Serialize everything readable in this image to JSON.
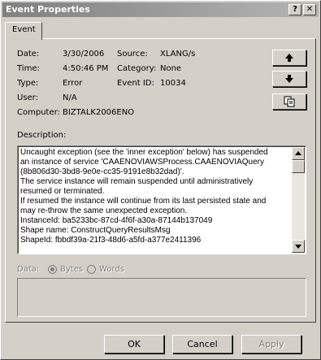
{
  "window": {
    "title": "Event Properties",
    "help_glyph": "?",
    "close_glyph": "✕"
  },
  "tabs": [
    {
      "label": "Event"
    }
  ],
  "fields": {
    "date": {
      "label": "Date:",
      "value": "3/30/2006"
    },
    "time": {
      "label": "Time:",
      "value": "4:50:46 PM"
    },
    "type": {
      "label": "Type:",
      "value": "Error"
    },
    "user": {
      "label": "User:",
      "value": "N/A"
    },
    "computer": {
      "label": "Computer:",
      "value": "BIZTALK2006ENO"
    },
    "source": {
      "label": "Source:",
      "value": "XLANG/s"
    },
    "category": {
      "label": "Category:",
      "value": "None"
    },
    "event_id": {
      "label": "Event ID:",
      "value": "10034"
    }
  },
  "side_buttons": {
    "up": "up-arrow-icon",
    "down": "down-arrow-icon",
    "copy": "copy-icon"
  },
  "description": {
    "label": "Description:",
    "text": "Uncaught exception (see the 'inner exception' below) has suspended\nan instance of service 'CAAENOVIAWSProcess.CAAENOVIAQuery\n(8b806d30-3bd8-9e0e-cc35-9191e8b32dad)'.\nThe service instance will remain suspended until administratively\nresumed or terminated.\nIf resumed the instance will continue from its last persisted state and\nmay re-throw the same unexpected exception.\nInstanceId: ba5233bc-87cd-4f6f-a30a-87144b137049\nShape name: ConstructQueryResultsMsg\nShapeId: fbbdf39a-21f3-48d6-a5fd-a377e2411396"
  },
  "data_section": {
    "label": "Data:",
    "option_bytes": "Bytes",
    "option_words": "Words",
    "selected": "Bytes"
  },
  "buttons": {
    "ok": "OK",
    "cancel": "Cancel",
    "apply": "Apply"
  }
}
